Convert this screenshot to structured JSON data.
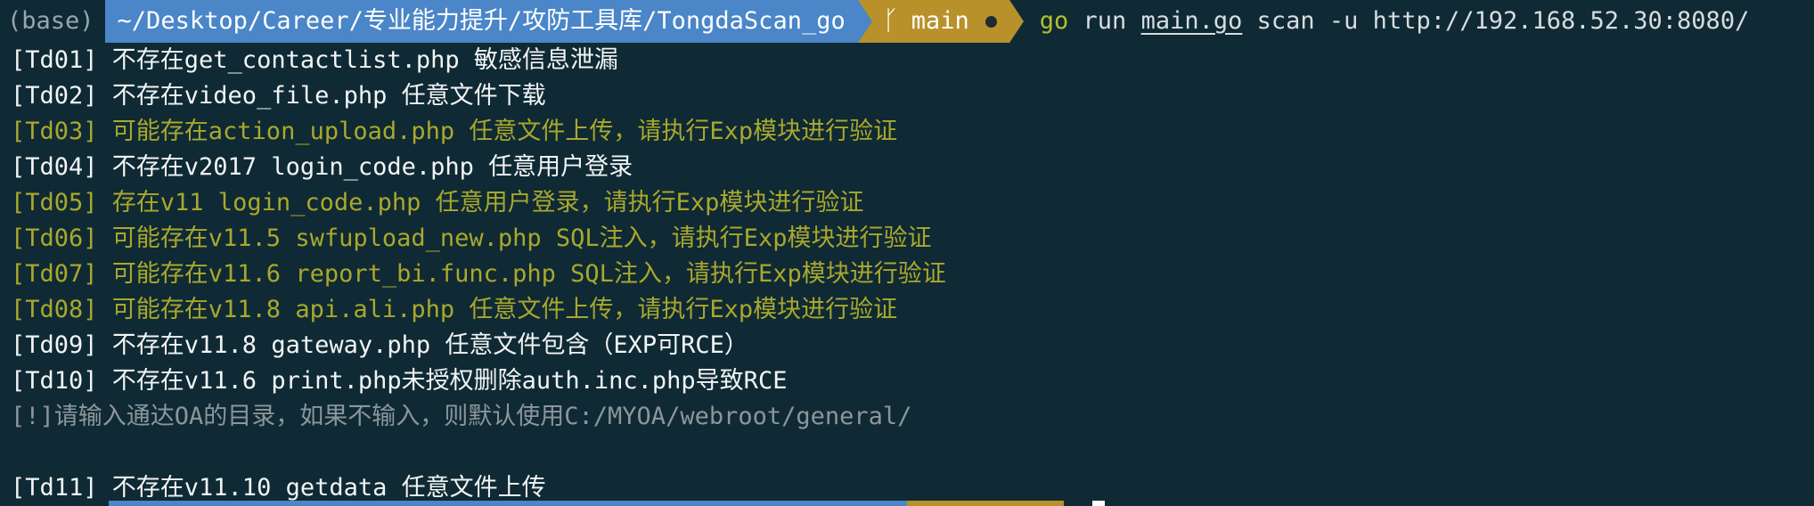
{
  "prompt": {
    "env": "(base)",
    "path": "~/Desktop/Career/专业能力提升/攻防工具库/TongdaScan_go",
    "branch_icon": "ᚴ",
    "branch": "main",
    "command_go": "go",
    "command_run": "run",
    "command_file": "main.go",
    "command_args": "scan -u http://192.168.52.30:8080/"
  },
  "output": [
    {
      "text": "[Td01] 不存在get_contactlist.php 敏感信息泄漏",
      "color": "white"
    },
    {
      "text": "[Td02] 不存在video_file.php 任意文件下载",
      "color": "white"
    },
    {
      "text": "[Td03] 可能存在action_upload.php 任意文件上传，请执行Exp模块进行验证",
      "color": "yellow"
    },
    {
      "text": "[Td04] 不存在v2017 login_code.php 任意用户登录",
      "color": "white"
    },
    {
      "text": "[Td05] 存在v11 login_code.php 任意用户登录，请执行Exp模块进行验证",
      "color": "yellow"
    },
    {
      "text": "[Td06] 可能存在v11.5 swfupload_new.php SQL注入，请执行Exp模块进行验证",
      "color": "yellow"
    },
    {
      "text": "[Td07] 可能存在v11.6 report_bi.func.php SQL注入，请执行Exp模块进行验证",
      "color": "yellow"
    },
    {
      "text": "[Td08] 可能存在v11.8 api.ali.php 任意文件上传，请执行Exp模块进行验证",
      "color": "yellow"
    },
    {
      "text": "[Td09] 不存在v11.8 gateway.php 任意文件包含（EXP可RCE）",
      "color": "white"
    },
    {
      "text": "[Td10] 不存在v11.6 print.php未授权删除auth.inc.php导致RCE",
      "color": "white"
    },
    {
      "text": "[!]请输入通达OA的目录，如果不输入，则默认使用C:/MYOA/webroot/general/",
      "color": "gray"
    },
    {
      "text": "",
      "color": "blank"
    },
    {
      "text": "[Td11] 不存在v11.10 getdata 任意文件上传",
      "color": "white"
    }
  ],
  "colors": {
    "background": "#0f2a34",
    "path_segment": "#4a86c8",
    "git_segment": "#b8912a",
    "output_white": "#f2f4f5",
    "output_yellow": "#a9a82c",
    "output_gray": "#8c969b",
    "command_go": "#b5bf2b"
  }
}
